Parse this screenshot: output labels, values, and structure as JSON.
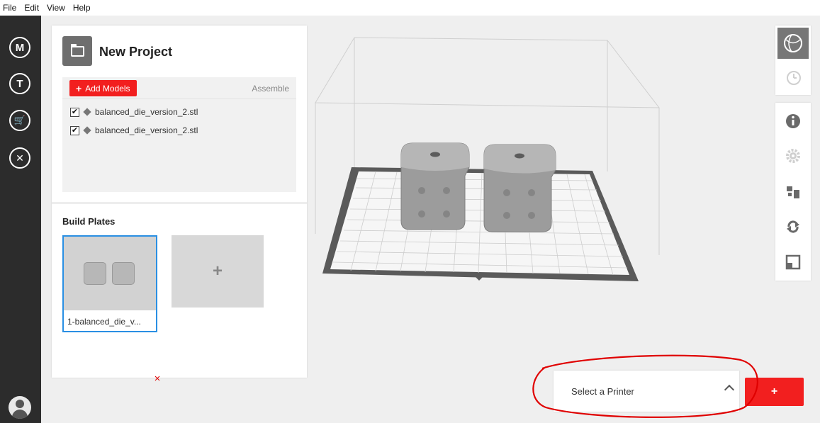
{
  "menu": [
    "File",
    "Edit",
    "View",
    "Help"
  ],
  "rail": {
    "icons": [
      "makerbot-icon",
      "thingiverse-icon",
      "store-icon",
      "utilities-icon"
    ],
    "glyphs": [
      "M",
      "T",
      "🛒",
      "✕"
    ]
  },
  "project": {
    "title": "New Project",
    "add_models_label": "Add Models",
    "add_plus": "+",
    "assemble_label": "Assemble",
    "checkmark": "✔",
    "models": [
      "balanced_die_version_2.stl",
      "balanced_die_version_2.stl"
    ],
    "models_checked": [
      true,
      true
    ]
  },
  "build_plates": {
    "title": "Build Plates",
    "plates": [
      "1-balanced_die_v..."
    ],
    "add_plus": "+"
  },
  "printer": {
    "label": "Select a Printer",
    "add_label": "+"
  },
  "colors": {
    "accent_red": "#f21f1f",
    "selection_blue": "#2a8fe3",
    "rail_dark": "#2c2c2c",
    "annotation_red": "#e00000"
  }
}
